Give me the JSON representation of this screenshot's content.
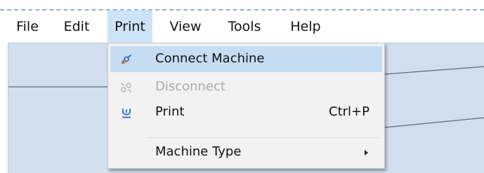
{
  "menubar": {
    "items": [
      {
        "label": "File"
      },
      {
        "label": "Edit"
      },
      {
        "label": "Print"
      },
      {
        "label": "View"
      },
      {
        "label": "Tools"
      },
      {
        "label": "Help"
      }
    ],
    "active": "Print"
  },
  "print_menu": {
    "items": [
      {
        "label": "Connect Machine",
        "icon": "connect-icon",
        "state": "highlighted"
      },
      {
        "label": "Disconnect",
        "icon": "disconnect-icon",
        "state": "disabled"
      },
      {
        "label": "Print",
        "icon": "print-icon",
        "shortcut": "Ctrl+P"
      },
      {
        "label": "Machine Type",
        "has_submenu": true
      }
    ]
  },
  "colors": {
    "menu_active_bg": "#cde3f7",
    "item_highlight_bg": "#c6ddf3",
    "workspace_bg": "#d2dfee",
    "disabled_text": "#a9a9a9",
    "icon_blue": "#2a6cc8"
  }
}
